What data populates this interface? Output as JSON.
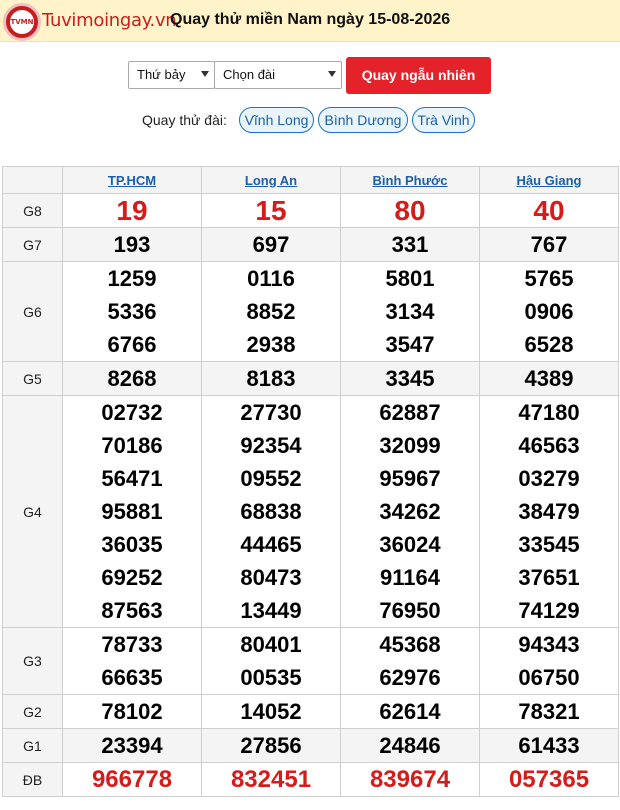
{
  "header": {
    "logo_badge": "TVMN",
    "logo_text": "Tuvimoingay.vn",
    "title": "Quay thử miền Nam ngày 15-08-2026"
  },
  "controls": {
    "day_select": "Thứ bảy",
    "station_select": "Chọn đài",
    "random_button": "Quay ngẫu nhiên"
  },
  "stations": {
    "label": "Quay thử đài:",
    "chips": [
      "Vĩnh Long",
      "Bình Dương",
      "Trà Vinh"
    ]
  },
  "table": {
    "columns": [
      "TP.HCM",
      "Long An",
      "Bình Phước",
      "Hậu Giang"
    ],
    "rows": [
      {
        "label": "G8",
        "cells": [
          [
            "19"
          ],
          [
            "15"
          ],
          [
            "80"
          ],
          [
            "40"
          ]
        ]
      },
      {
        "label": "G7",
        "cells": [
          [
            "193"
          ],
          [
            "697"
          ],
          [
            "331"
          ],
          [
            "767"
          ]
        ]
      },
      {
        "label": "G6",
        "cells": [
          [
            "1259",
            "5336",
            "6766"
          ],
          [
            "0116",
            "8852",
            "2938"
          ],
          [
            "5801",
            "3134",
            "3547"
          ],
          [
            "5765",
            "0906",
            "6528"
          ]
        ]
      },
      {
        "label": "G5",
        "cells": [
          [
            "8268"
          ],
          [
            "8183"
          ],
          [
            "3345"
          ],
          [
            "4389"
          ]
        ]
      },
      {
        "label": "G4",
        "cells": [
          [
            "02732",
            "70186",
            "56471",
            "95881",
            "36035",
            "69252",
            "87563"
          ],
          [
            "27730",
            "92354",
            "09552",
            "68838",
            "44465",
            "80473",
            "13449"
          ],
          [
            "62887",
            "32099",
            "95967",
            "34262",
            "36024",
            "91164",
            "76950"
          ],
          [
            "47180",
            "46563",
            "03279",
            "38479",
            "33545",
            "37651",
            "74129"
          ]
        ]
      },
      {
        "label": "G3",
        "cells": [
          [
            "78733",
            "66635"
          ],
          [
            "80401",
            "00535"
          ],
          [
            "45368",
            "62976"
          ],
          [
            "94343",
            "06750"
          ]
        ]
      },
      {
        "label": "G2",
        "cells": [
          [
            "78102"
          ],
          [
            "14052"
          ],
          [
            "62614"
          ],
          [
            "78321"
          ]
        ]
      },
      {
        "label": "G1",
        "cells": [
          [
            "23394"
          ],
          [
            "27856"
          ],
          [
            "24846"
          ],
          [
            "61433"
          ]
        ]
      },
      {
        "label": "ĐB",
        "cells": [
          [
            "966778"
          ],
          [
            "832451"
          ],
          [
            "839674"
          ],
          [
            "057365"
          ]
        ]
      }
    ]
  }
}
